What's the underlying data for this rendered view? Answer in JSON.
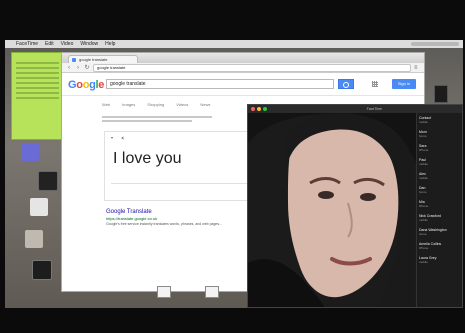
{
  "menubar": {
    "app_name": "FaceTime",
    "items": [
      "Edit",
      "Video",
      "Window",
      "Help"
    ]
  },
  "browser": {
    "tab_title": "google translate",
    "address": "google translate",
    "search_query": "google translate",
    "google_logo": "Google",
    "signin_label": "Sign in",
    "search_tabs": [
      "Web",
      "Images",
      "Shopping",
      "Videos",
      "News"
    ],
    "translation_text": "I love you",
    "result": {
      "title": "Google Translate",
      "url": "https://translate.google.co.uk",
      "snippet": "Google's free service instantly translates words, phrases, and web pages..."
    }
  },
  "facetime": {
    "window_title": "FaceTime",
    "contacts": [
      {
        "name": "Contact",
        "detail": "mobile"
      },
      {
        "name": "Mom",
        "detail": "home"
      },
      {
        "name": "Sara",
        "detail": "iPhone"
      },
      {
        "name": "Paul",
        "detail": "mobile"
      },
      {
        "name": "Alex",
        "detail": "mobile"
      },
      {
        "name": "Dan",
        "detail": "home"
      },
      {
        "name": "Mia",
        "detail": "iPhone"
      },
      {
        "name": "Nick Crawford",
        "detail": "mobile"
      },
      {
        "name": "Dana Washington",
        "detail": "home"
      },
      {
        "name": "Amelia Collins",
        "detail": "iPhone"
      },
      {
        "name": "Laura Grey",
        "detail": "mobile"
      }
    ]
  },
  "colors": {
    "google_blue": "#4285f4",
    "sticky_note": "#b7e35b"
  }
}
